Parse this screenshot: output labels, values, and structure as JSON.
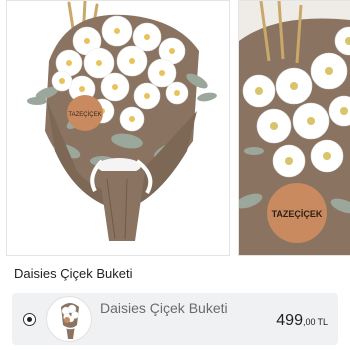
{
  "product": {
    "title": "Daisies Çiçek Buketi"
  },
  "gallery": {
    "images": [
      {
        "icon": "daisy-bouquet-photo",
        "brand_tag": "TAZEÇİÇEK"
      },
      {
        "icon": "daisy-bouquet-closeup-photo",
        "brand_tag": "TAZEÇİÇEK"
      }
    ]
  },
  "options": [
    {
      "name": "Daisies Çiçek Buketi",
      "price_int": "499",
      "price_dec": ",00",
      "currency": "TL",
      "selected": true
    }
  ],
  "colors": {
    "kraft": "#8f7a66",
    "tag": "#c88a5e",
    "leaf": "#9aa79a",
    "option_bg": "#f0f1f3"
  }
}
